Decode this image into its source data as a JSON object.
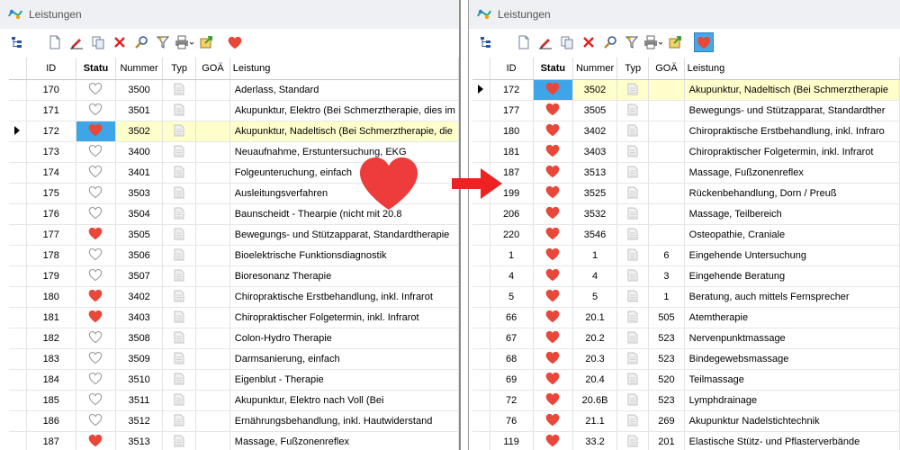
{
  "colors": {
    "heart": "#e8473a",
    "overlay_heart": "#ee3b3b",
    "arrow": "#ee2222",
    "selection_status": "#3da5e8",
    "selection_row": "#ffffcc"
  },
  "left_window": {
    "title": "Leistungen",
    "columns": [
      "ID",
      "Statu",
      "Nummer",
      "Typ",
      "GOÄ",
      "Leistung"
    ],
    "rows": [
      {
        "id": "170",
        "status": "empty",
        "nummer": "3500",
        "goa": "",
        "leistung": "Aderlass, Standard"
      },
      {
        "id": "171",
        "status": "empty",
        "nummer": "3501",
        "goa": "",
        "leistung": "Akupunktur, Elektro (Bei Schmerztherapie, dies im"
      },
      {
        "id": "172",
        "status": "filled",
        "nummer": "3502",
        "goa": "",
        "leistung": "Akupunktur, Nadeltisch  (Bei Schmerztherapie, die",
        "selected": true
      },
      {
        "id": "173",
        "status": "empty",
        "nummer": "3400",
        "goa": "",
        "leistung": "Neuaufnahme, Erstuntersuchung, EKG"
      },
      {
        "id": "174",
        "status": "empty",
        "nummer": "3401",
        "goa": "",
        "leistung": "Folgeunteruchung, einfach"
      },
      {
        "id": "175",
        "status": "empty",
        "nummer": "3503",
        "goa": "",
        "leistung": "Ausleitungsverfahren"
      },
      {
        "id": "176",
        "status": "empty",
        "nummer": "3504",
        "goa": "",
        "leistung": "Baunscheidt - Thearpie (nicht mit 20.8"
      },
      {
        "id": "177",
        "status": "filled",
        "nummer": "3505",
        "goa": "",
        "leistung": "Bewegungs- und Stützapparat, Standardtherapie"
      },
      {
        "id": "178",
        "status": "empty",
        "nummer": "3506",
        "goa": "",
        "leistung": "Bioelektrische Funktionsdiagnostik"
      },
      {
        "id": "179",
        "status": "empty",
        "nummer": "3507",
        "goa": "",
        "leistung": "Bioresonanz Therapie"
      },
      {
        "id": "180",
        "status": "filled",
        "nummer": "3402",
        "goa": "",
        "leistung": "Chiropraktische Erstbehandlung, inkl. Infrarot"
      },
      {
        "id": "181",
        "status": "filled",
        "nummer": "3403",
        "goa": "",
        "leistung": "Chiropraktischer Folgetermin, inkl. Infrarot"
      },
      {
        "id": "182",
        "status": "empty",
        "nummer": "3508",
        "goa": "",
        "leistung": "Colon-Hydro Therapie"
      },
      {
        "id": "183",
        "status": "empty",
        "nummer": "3509",
        "goa": "",
        "leistung": "Darmsanierung, einfach"
      },
      {
        "id": "184",
        "status": "empty",
        "nummer": "3510",
        "goa": "",
        "leistung": "Eigenblut - Therapie"
      },
      {
        "id": "185",
        "status": "empty",
        "nummer": "3511",
        "goa": "",
        "leistung": "Akupunktur, Elektro nach Voll  (Bei"
      },
      {
        "id": "186",
        "status": "empty",
        "nummer": "3512",
        "goa": "",
        "leistung": "Ernährungsbehandlung, inkl. Hautwiderstand"
      },
      {
        "id": "187",
        "status": "filled",
        "nummer": "3513",
        "goa": "",
        "leistung": "Massage, Fußzonenreflex"
      }
    ]
  },
  "right_window": {
    "title": "Leistungen",
    "columns": [
      "ID",
      "Statu",
      "Nummer",
      "Typ",
      "GOÄ",
      "Leistung"
    ],
    "rows": [
      {
        "id": "172",
        "status": "filled",
        "nummer": "3502",
        "goa": "",
        "leistung": "Akupunktur, Nadeltisch  (Bei Schmerztherapie",
        "selected": true
      },
      {
        "id": "177",
        "status": "filled",
        "nummer": "3505",
        "goa": "",
        "leistung": "Bewegungs- und Stützapparat, Standardther"
      },
      {
        "id": "180",
        "status": "filled",
        "nummer": "3402",
        "goa": "",
        "leistung": "Chiropraktische Erstbehandlung, inkl. Infraro"
      },
      {
        "id": "181",
        "status": "filled",
        "nummer": "3403",
        "goa": "",
        "leistung": "Chiropraktischer Folgetermin, inkl. Infrarot"
      },
      {
        "id": "187",
        "status": "filled",
        "nummer": "3513",
        "goa": "",
        "leistung": "Massage, Fußzonenreflex"
      },
      {
        "id": "199",
        "status": "filled",
        "nummer": "3525",
        "goa": "",
        "leistung": "Rückenbehandlung, Dorn / Preuß"
      },
      {
        "id": "206",
        "status": "filled",
        "nummer": "3532",
        "goa": "",
        "leistung": "Massage, Teilbereich"
      },
      {
        "id": "220",
        "status": "filled",
        "nummer": "3546",
        "goa": "",
        "leistung": "Osteopathie, Craniale"
      },
      {
        "id": "1",
        "status": "filled",
        "nummer": "1",
        "goa": "6",
        "leistung": "Eingehende Untersuchung"
      },
      {
        "id": "4",
        "status": "filled",
        "nummer": "4",
        "goa": "3",
        "leistung": "Eingehende Beratung"
      },
      {
        "id": "5",
        "status": "filled",
        "nummer": "5",
        "goa": "1",
        "leistung": "Beratung, auch mittels Fernsprecher"
      },
      {
        "id": "66",
        "status": "filled",
        "nummer": "20.1",
        "goa": "505",
        "leistung": "Atemtherapie"
      },
      {
        "id": "67",
        "status": "filled",
        "nummer": "20.2",
        "goa": "523",
        "leistung": "Nervenpunktmassage"
      },
      {
        "id": "68",
        "status": "filled",
        "nummer": "20.3",
        "goa": "523",
        "leistung": "Bindegewebsmassage"
      },
      {
        "id": "69",
        "status": "filled",
        "nummer": "20.4",
        "goa": "520",
        "leistung": "Teilmassage"
      },
      {
        "id": "72",
        "status": "filled",
        "nummer": "20.6B",
        "goa": "523",
        "leistung": "Lymphdrainage"
      },
      {
        "id": "76",
        "status": "filled",
        "nummer": "21.1",
        "goa": "269",
        "leistung": "Akupunktur Nadelstichtechnik"
      },
      {
        "id": "119",
        "status": "filled",
        "nummer": "33.2",
        "goa": "201",
        "leistung": "Elastische Stütz- und Pflasterverbände"
      }
    ]
  }
}
